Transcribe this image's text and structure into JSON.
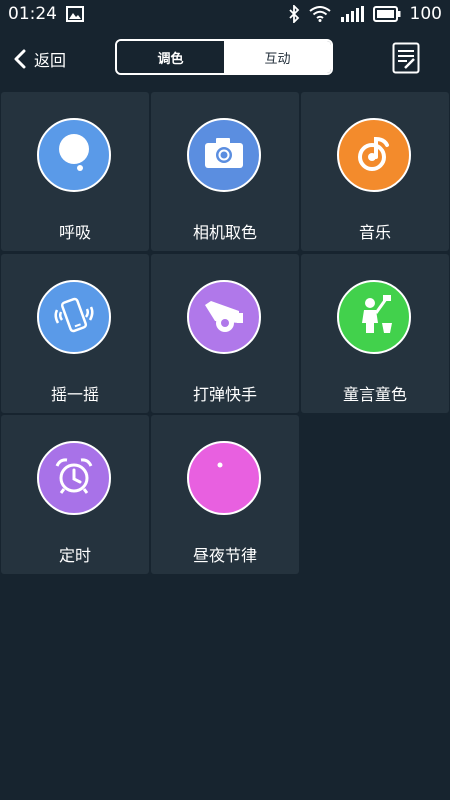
{
  "status_bar": {
    "time": "01:24",
    "battery": "100",
    "icons": [
      "image-icon",
      "bluetooth-icon",
      "wifi-icon",
      "signal-icon",
      "battery-icon"
    ]
  },
  "header": {
    "back_label": "返回",
    "tabs": [
      {
        "label": "调色",
        "active": true
      },
      {
        "label": "互动",
        "active": false
      }
    ],
    "note_icon": "note-edit-icon"
  },
  "modes": [
    {
      "label": "呼吸",
      "icon": "speech-bubble-icon",
      "color": "#5a9ae8"
    },
    {
      "label": "相机取色",
      "icon": "camera-icon",
      "color": "#5b8ee0"
    },
    {
      "label": "音乐",
      "icon": "music-note-icon",
      "color": "#f38b2c"
    },
    {
      "label": "摇一摇",
      "icon": "phone-shake-icon",
      "color": "#5a9ae8"
    },
    {
      "label": "打弹快手",
      "icon": "cannon-icon",
      "color": "#b078ea"
    },
    {
      "label": "童言童色",
      "icon": "painter-icon",
      "color": "#42d14c"
    },
    {
      "label": "定时",
      "icon": "alarm-clock-icon",
      "color": "#a872e8"
    },
    {
      "label": "昼夜节律",
      "icon": "moon-icon",
      "color": "#e860e0"
    }
  ],
  "colors": {
    "background": "#17242f",
    "tile": "#25333e"
  }
}
